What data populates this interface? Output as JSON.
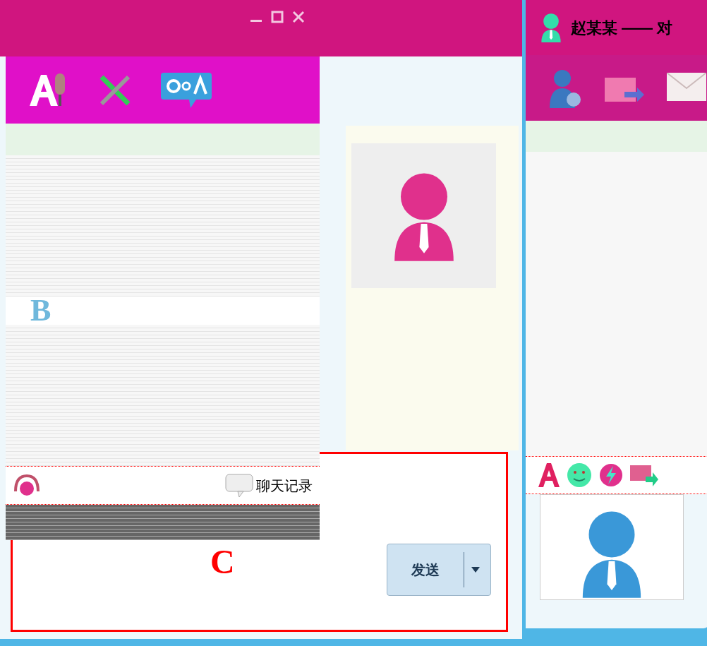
{
  "back_window": {
    "input_area": {
      "label": "C"
    },
    "send_button": {
      "label": "发送"
    }
  },
  "left_window": {
    "chat_area": {
      "label": "B"
    },
    "bottom_toolbar": {
      "history_link": "聊天记录"
    }
  },
  "right_window": {
    "title": "赵某某 —— 对"
  }
}
